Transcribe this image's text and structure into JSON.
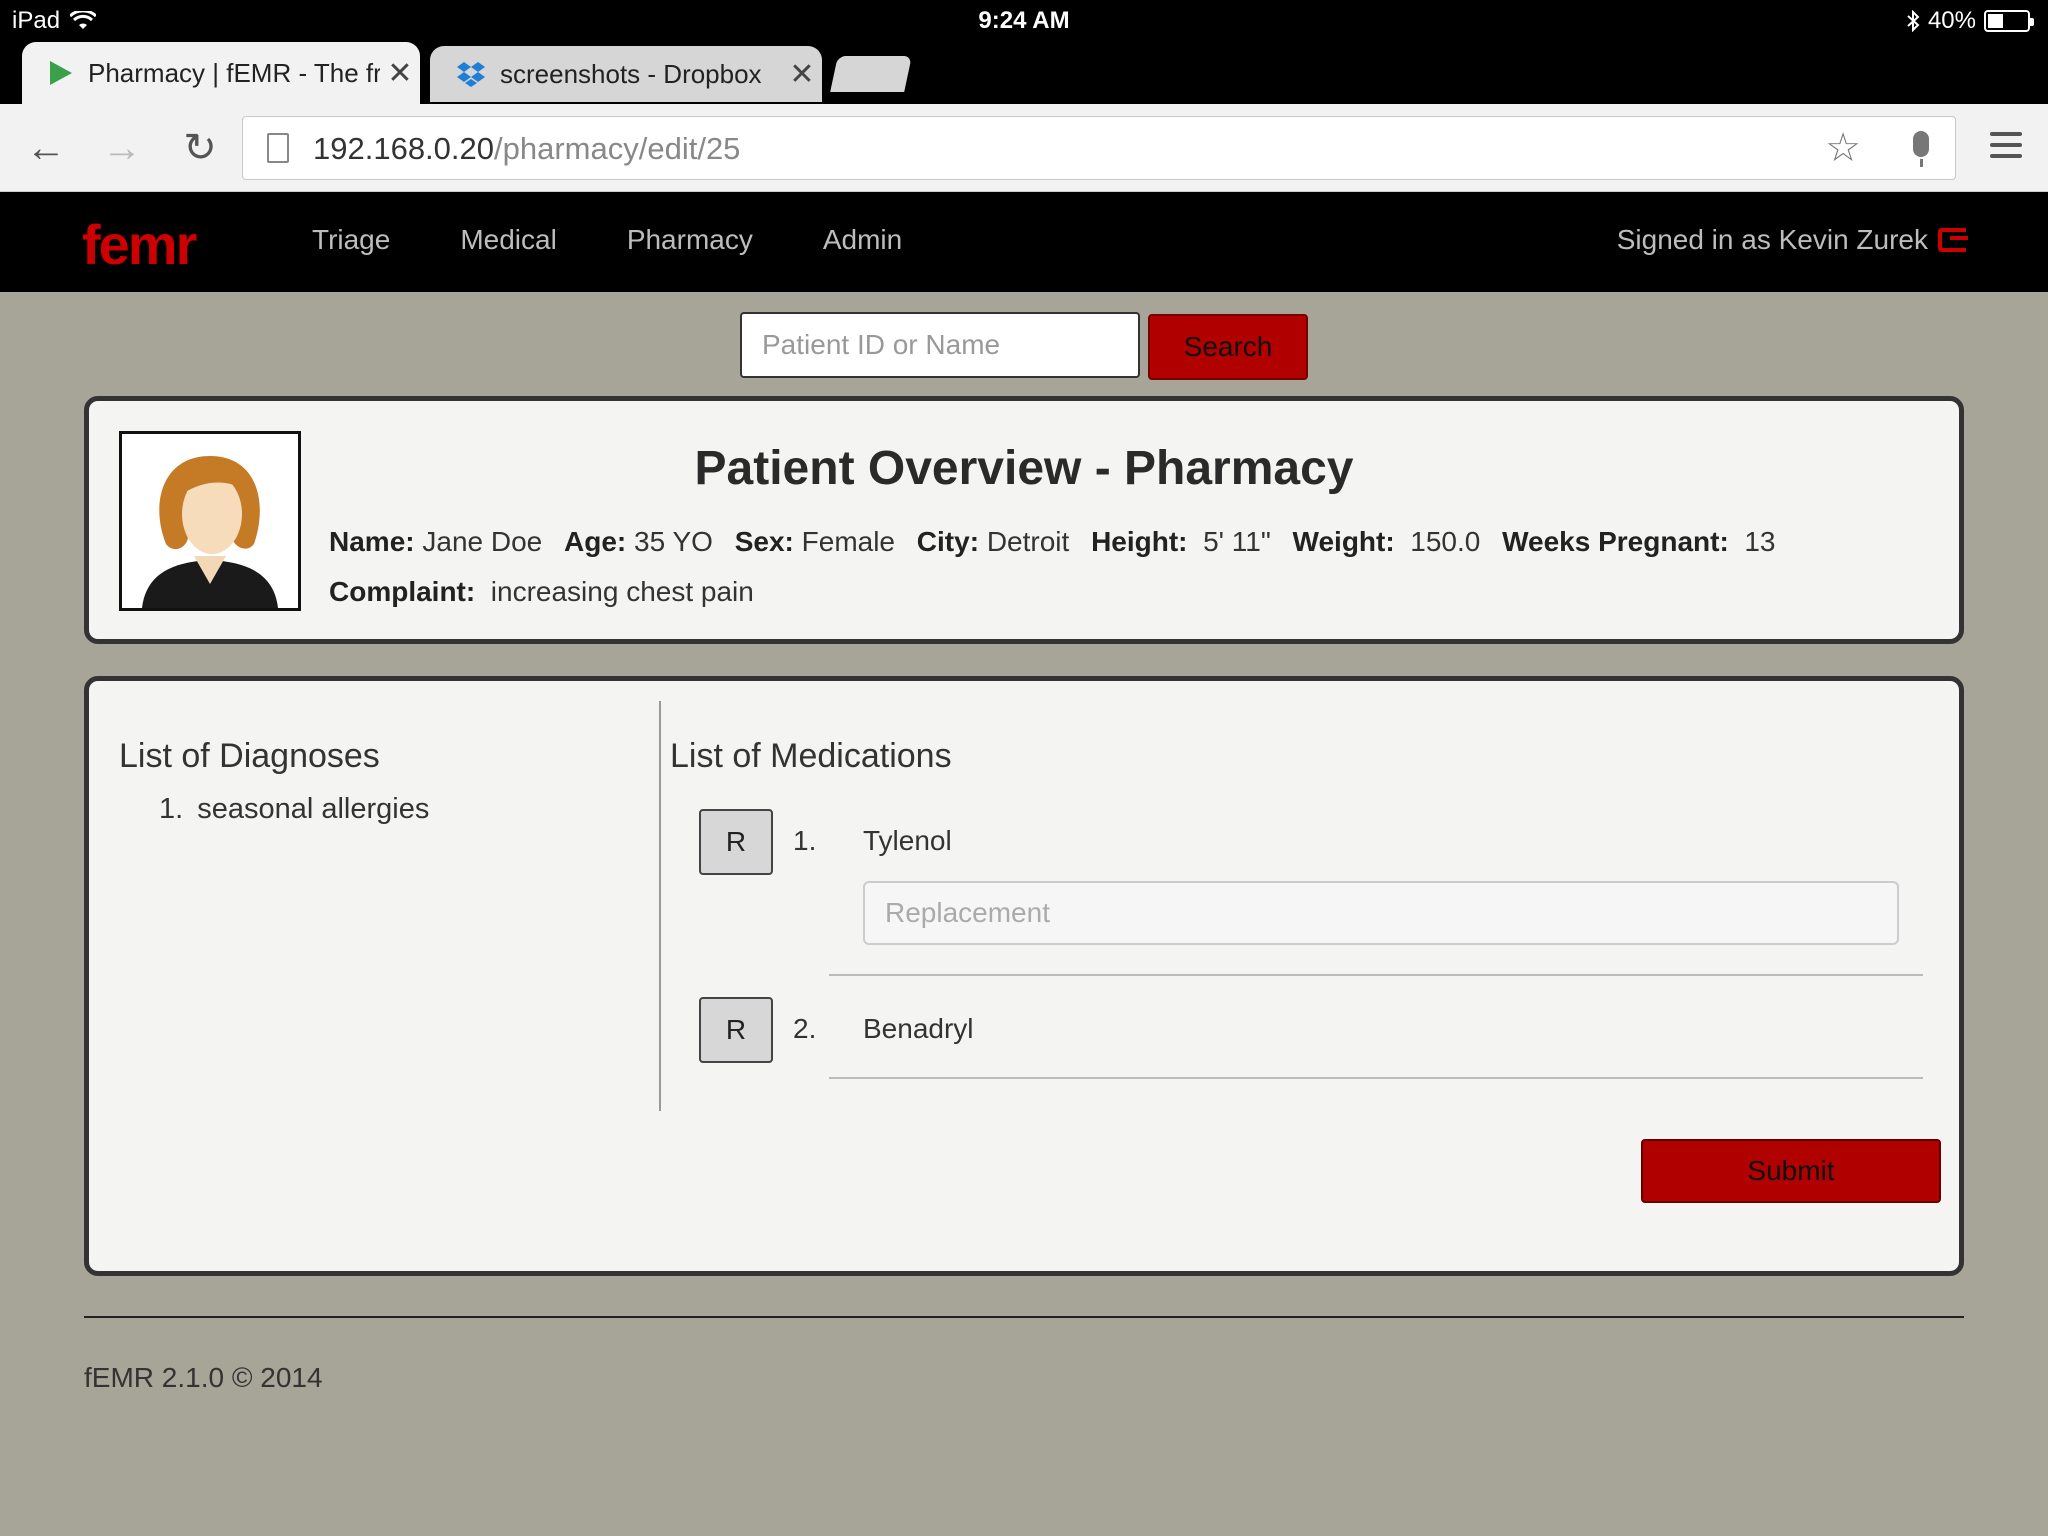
{
  "status_bar": {
    "device": "iPad",
    "time": "9:24 AM",
    "battery": "40%",
    "battery_level": 0.4
  },
  "tabs": [
    {
      "title": "Pharmacy | fEMR - The fre",
      "active": true,
      "icon": "play-triangle-icon"
    },
    {
      "title": "screenshots - Dropbox",
      "active": false,
      "icon": "dropbox-icon"
    }
  ],
  "address_bar": {
    "host": "192.168.0.20",
    "path": "/pharmacy/edit/25"
  },
  "app": {
    "logo": "femr",
    "nav": [
      "Triage",
      "Medical",
      "Pharmacy",
      "Admin"
    ],
    "signed_in": "Signed in as Kevin Zurek"
  },
  "search": {
    "placeholder": "Patient ID or Name",
    "button": "Search"
  },
  "overview": {
    "title": "Patient Overview - Pharmacy",
    "fields": [
      {
        "label": "Name:",
        "value": "Jane Doe"
      },
      {
        "label": "Age:",
        "value": "35 YO"
      },
      {
        "label": "Sex:",
        "value": "Female"
      },
      {
        "label": "City:",
        "value": "Detroit"
      },
      {
        "label": "Height:",
        "value": "5' 11\""
      },
      {
        "label": "Weight:",
        "value": "150.0"
      },
      {
        "label": "Weeks Pregnant:",
        "value": "13"
      },
      {
        "label": "Complaint:",
        "value": "increasing chest pain"
      }
    ]
  },
  "diagnoses": {
    "heading": "List of Diagnoses",
    "items": [
      {
        "num": "1.",
        "text": "seasonal allergies"
      }
    ]
  },
  "medications": {
    "heading": "List of Medications",
    "items": [
      {
        "button": "R",
        "num": "1.",
        "name": "Tylenol",
        "replacement_placeholder": "Replacement"
      },
      {
        "button": "R",
        "num": "2.",
        "name": "Benadryl"
      }
    ],
    "submit": "Submit"
  },
  "footer": "fEMR 2.1.0 © 2014"
}
